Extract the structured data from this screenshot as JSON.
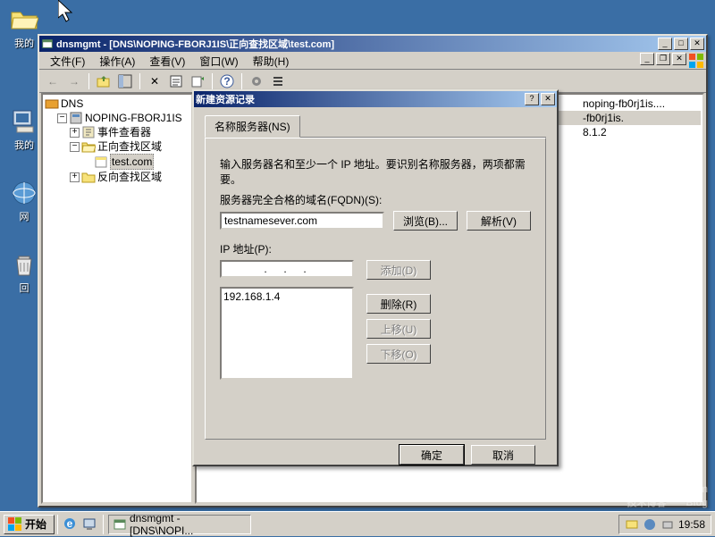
{
  "desktop": {
    "icons": [
      {
        "name": "folder-icon",
        "label": "我的"
      },
      {
        "name": "computer-icon",
        "label": "我的"
      },
      {
        "name": "network-icon",
        "label": "网"
      },
      {
        "name": "recycle-icon",
        "label": "回"
      }
    ]
  },
  "mmc": {
    "title": "dnsmgmt - [DNS\\NOPING-FBORJ1IS\\正向查找区域\\test.com]",
    "menus": {
      "file": "文件(F)",
      "action": "操作(A)",
      "view": "查看(V)",
      "window": "窗口(W)",
      "help": "帮助(H)"
    },
    "tree": {
      "root": "DNS",
      "server": "NOPING-FBORJ1IS",
      "event": "事件查看器",
      "fwd": "正向查找区域",
      "zone": "test.com",
      "rev": "反向查找区域"
    },
    "list": {
      "rows": [
        {
          "text": "noping-fb0rj1is....",
          "sel": false
        },
        {
          "text": "-fb0rj1is.",
          "sel": true
        },
        {
          "text": "8.1.2",
          "sel": false
        }
      ]
    }
  },
  "dialog": {
    "title": "新建资源记录",
    "tab": "名称服务器(NS)",
    "instruction": "输入服务器名和至少一个 IP 地址。要识别名称服务器，两项都需要。",
    "fqdn_label": "服务器完全合格的域名(FQDN)(S):",
    "fqdn_value": "testnamesever.com",
    "browse_btn": "浏览(B)...",
    "resolve_btn": "解析(V)",
    "ip_label": "IP 地址(P):",
    "ip_value": "",
    "add_btn": "添加(D)",
    "remove_btn": "删除(R)",
    "up_btn": "上移(U)",
    "down_btn": "下移(O)",
    "ip_list": [
      "192.168.1.4"
    ],
    "ok": "确定",
    "cancel": "取消"
  },
  "taskbar": {
    "start": "开始",
    "task1": "dnsmgmt - [DNS\\NOPI...",
    "clock": "19:58"
  },
  "watermark": {
    "main": "51CTO.com",
    "sub": "技术博客——Blog"
  }
}
